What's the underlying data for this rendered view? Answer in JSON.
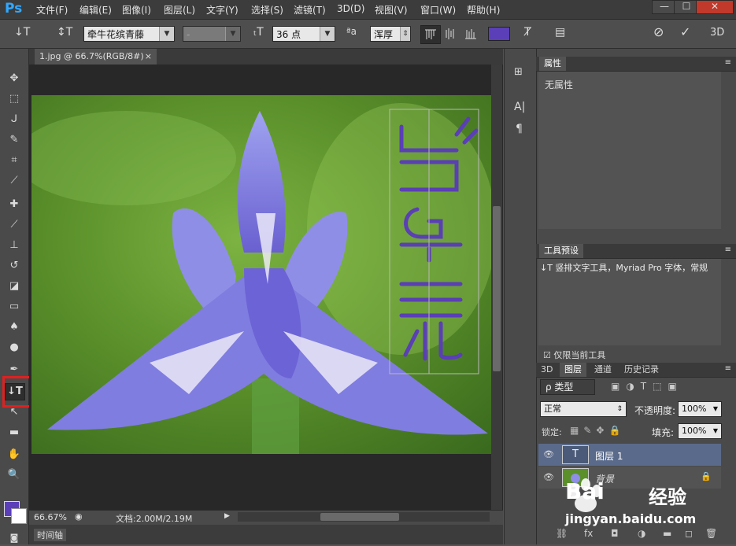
{
  "app": {
    "logo": "Ps"
  },
  "menu": [
    "文件(F)",
    "编辑(E)",
    "图像(I)",
    "图层(L)",
    "文字(Y)",
    "选择(S)",
    "滤镜(T)",
    "3D(D)",
    "视图(V)",
    "窗口(W)",
    "帮助(H)"
  ],
  "window_controls": {
    "minimize": "—",
    "restore": "☐",
    "close": "✕"
  },
  "options": {
    "tool_icon": "↓T",
    "font_family": "牵牛花缤青藤",
    "font_style": "-",
    "font_size": "36 点",
    "aa_label": "ªa",
    "antialias": "浑厚",
    "text_color": "#5b3fb8",
    "mode_3d": "3D"
  },
  "document": {
    "tab_title": "1.jpg @ 66.7%(RGB/8#)",
    "tab_close": "×",
    "zoom": "66.67%",
    "doc_size": "文档:2.00M/2.19M",
    "timeline": "时间轴",
    "vertical_text": [
      "鸢",
      "尾",
      "花"
    ]
  },
  "colors": {
    "foreground": "#5b3fb8",
    "background": "#ffffff",
    "highlight": "#e02020",
    "text_fill": "#5a3fb5"
  },
  "properties_panel": {
    "tab": "属性",
    "content": "无属性"
  },
  "tool_presets": {
    "tab": "工具预设",
    "item": "↓T 竖排文字工具，Myriad Pro 字体，常规",
    "checkbox_label": "仅限当前工具",
    "checked": true
  },
  "layers_panel": {
    "tabs": [
      "3D",
      "图层",
      "通道",
      "历史记录"
    ],
    "active_tab": "图层",
    "filter_label": "ρ 类型",
    "blend_mode": "正常",
    "opacity_label": "不透明度:",
    "opacity": "100%",
    "lock_label": "锁定:",
    "fill_label": "填充:",
    "fill": "100%",
    "layers": [
      {
        "name": "图层 1",
        "thumb": "T",
        "selected": true
      },
      {
        "name": "背景",
        "thumb": "",
        "selected": false,
        "locked": true
      }
    ]
  },
  "watermark": {
    "brand": "Bai",
    "brand2": "经验",
    "url": "jingyan.baidu.com"
  }
}
